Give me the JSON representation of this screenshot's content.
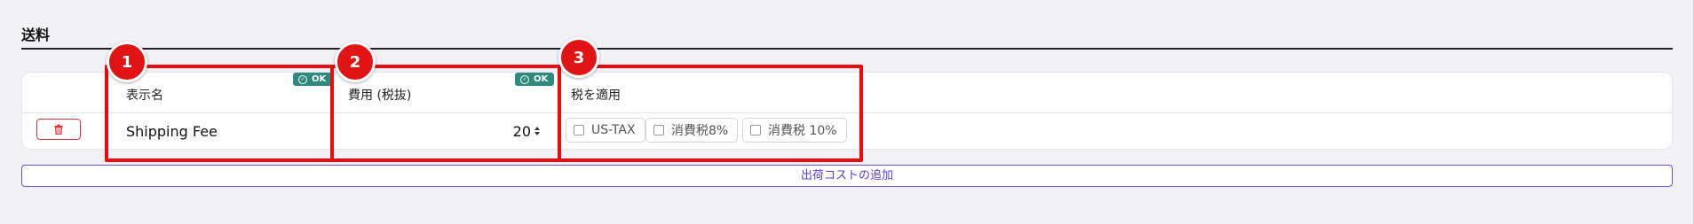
{
  "section": {
    "title": "送料"
  },
  "table": {
    "columns": {
      "name": "表示名",
      "cost": "費用 (税抜)",
      "tax": "税を適用"
    },
    "badges": {
      "ok": "OK"
    },
    "row": {
      "name": "Shipping Fee",
      "cost": "20",
      "taxes": [
        {
          "label": "US-TAX",
          "checked": false
        },
        {
          "label": "消費税8%",
          "checked": false
        },
        {
          "label": "消費税 10%",
          "checked": false
        }
      ]
    }
  },
  "add_button": {
    "label": "出荷コストの追加"
  },
  "annotations": [
    "1",
    "2",
    "3"
  ],
  "colors": {
    "highlight": "#ee0a0a",
    "ok_badge": "#2f8a7e",
    "accent": "#5a3fe0",
    "delete": "#e0323c"
  },
  "icons": {
    "delete": "trash-icon",
    "ok": "check-circle-icon"
  }
}
